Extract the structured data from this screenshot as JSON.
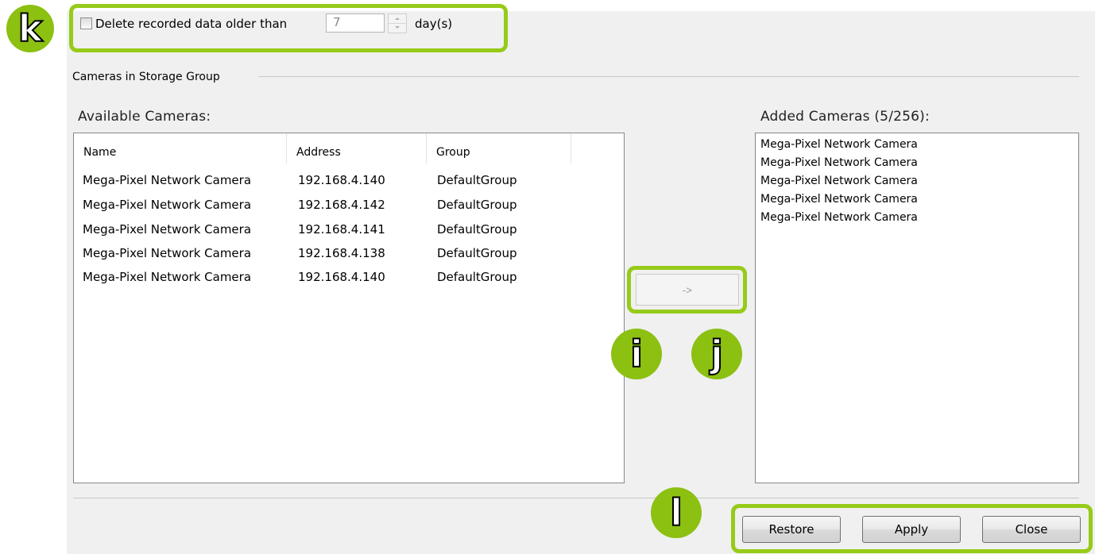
{
  "retention": {
    "checkbox_label": "Delete recorded data older than",
    "days_value": "7",
    "days_unit": "day(s)",
    "checked": false
  },
  "group": {
    "title": "Cameras in Storage Group"
  },
  "available": {
    "label": "Available Cameras:",
    "columns": [
      "Name",
      "Address",
      "Group"
    ],
    "rows": [
      {
        "name": "Mega-Pixel Network Camera",
        "address": "192.168.4.140",
        "group": "DefaultGroup"
      },
      {
        "name": "Mega-Pixel Network Camera",
        "address": "192.168.4.142",
        "group": "DefaultGroup"
      },
      {
        "name": "Mega-Pixel Network Camera",
        "address": "192.168.4.141",
        "group": "DefaultGroup"
      },
      {
        "name": "Mega-Pixel Network Camera",
        "address": "192.168.4.138",
        "group": "DefaultGroup"
      },
      {
        "name": "Mega-Pixel Network Camera",
        "address": "192.168.4.140",
        "group": "DefaultGroup"
      }
    ]
  },
  "added": {
    "label": "Added Cameras (5/256):",
    "items": [
      "Mega-Pixel Network Camera",
      "Mega-Pixel Network Camera",
      "Mega-Pixel Network Camera",
      "Mega-Pixel Network Camera",
      "Mega-Pixel Network Camera"
    ]
  },
  "move_button": {
    "label": "->"
  },
  "buttons": {
    "restore": "Restore",
    "apply": "Apply",
    "close": "Close"
  },
  "annotations": {
    "k": "k",
    "i": "i",
    "j": "j",
    "l": "l"
  },
  "colors": {
    "annotation_green": "#8cc011",
    "panel_bg": "#f0f0f0"
  }
}
